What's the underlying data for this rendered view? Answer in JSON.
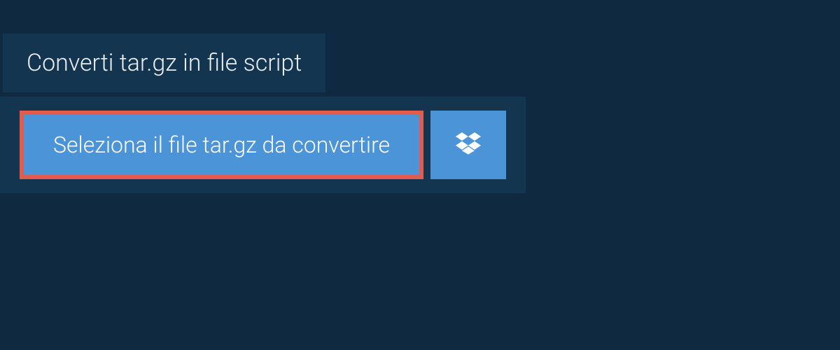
{
  "header": {
    "title": "Converti tar.gz in file script"
  },
  "actions": {
    "select_file_label": "Seleziona il file tar.gz da convertire"
  },
  "colors": {
    "page_bg": "#0f2940",
    "panel_bg": "#14354f",
    "button_bg": "#4b94d8",
    "highlight_border": "#e15b4f",
    "text_light": "#e8eef3"
  }
}
